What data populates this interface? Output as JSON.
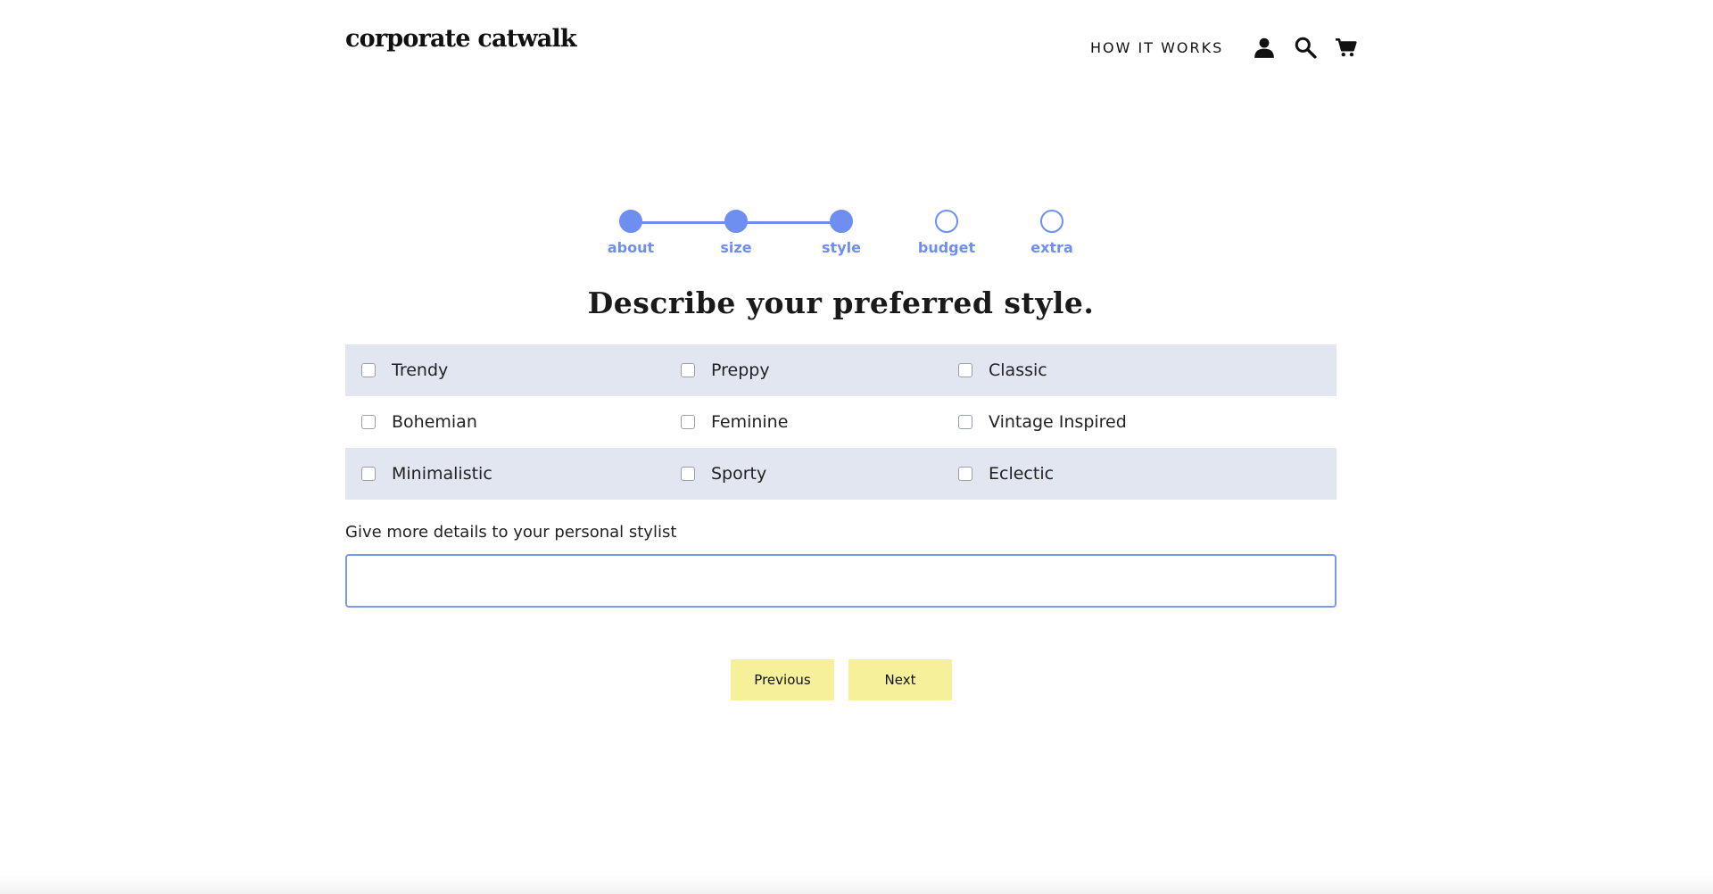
{
  "header": {
    "logo": "corporate catwalk",
    "nav_link": "HOW IT WORKS",
    "icons": [
      "account-icon",
      "search-icon",
      "cart-icon"
    ]
  },
  "stepper": {
    "steps": [
      {
        "label": "about",
        "state": "done"
      },
      {
        "label": "size",
        "state": "done"
      },
      {
        "label": "style",
        "state": "done"
      },
      {
        "label": "budget",
        "state": "pending"
      },
      {
        "label": "extra",
        "state": "pending"
      }
    ],
    "current": "style"
  },
  "main": {
    "heading": "Describe your preferred style.",
    "options": [
      [
        "Trendy",
        "Preppy",
        "Classic"
      ],
      [
        "Bohemian",
        "Feminine",
        "Vintage Inspired"
      ],
      [
        "Minimalistic",
        "Sporty",
        "Eclectic"
      ]
    ],
    "details_label": "Give more details to your personal stylist",
    "details_value": "",
    "details_placeholder": ""
  },
  "buttons": {
    "previous": "Previous",
    "next": "Next"
  },
  "colors": {
    "accent": "#6e8ef0",
    "option_row_shade": "#e1e6f1",
    "button_bg": "#f6f09a"
  }
}
